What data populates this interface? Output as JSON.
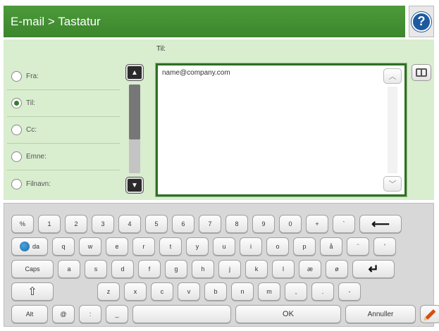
{
  "header": {
    "title": "E-mail > Tastatur",
    "help_symbol": "?"
  },
  "to_label": "Til:",
  "fields": [
    {
      "label": "Fra:",
      "selected": false
    },
    {
      "label": "Til:",
      "selected": true
    },
    {
      "label": "Cc:",
      "selected": false
    },
    {
      "label": "Emne:",
      "selected": false
    },
    {
      "label": "Filnavn:",
      "selected": false
    }
  ],
  "text_area": {
    "value": "name@company.com"
  },
  "keyboard": {
    "row1": [
      "%",
      "1",
      "2",
      "3",
      "4",
      "5",
      "6",
      "7",
      "8",
      "9",
      "0",
      "+",
      "`"
    ],
    "row2": [
      "q",
      "w",
      "e",
      "r",
      "t",
      "y",
      "u",
      "i",
      "o",
      "p",
      "å",
      "¨",
      "'"
    ],
    "row3": [
      "a",
      "s",
      "d",
      "f",
      "g",
      "h",
      "j",
      "k",
      "l",
      "æ",
      "ø"
    ],
    "row4": [
      "z",
      "x",
      "c",
      "v",
      "b",
      "n",
      "m",
      ",",
      ".",
      "-"
    ],
    "lang_label": "da",
    "caps_label": "Caps",
    "shift_symbol": "⇧",
    "backspace_symbol": "⟵",
    "enter_symbol": "↵",
    "alt_label": "Alt",
    "at_label": "@",
    "colon_label": ":",
    "underscore_label": "_",
    "ok_label": "OK",
    "cancel_label": "Annuller"
  },
  "colors": {
    "header_bg": "#3c862c",
    "panel_bg": "#d9edcf",
    "accent": "#2f6f25"
  }
}
